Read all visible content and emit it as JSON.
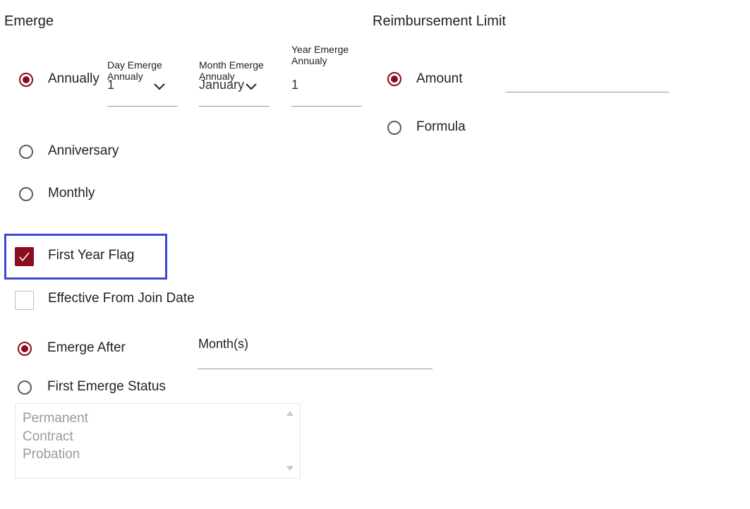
{
  "emerge": {
    "title": "Emerge",
    "options": {
      "annually": {
        "label": "Annually",
        "selected": true
      },
      "anniversary": {
        "label": "Anniversary",
        "selected": false
      },
      "monthly": {
        "label": "Monthly",
        "selected": false
      }
    },
    "day_field": {
      "label": "Day Emerge Annualy",
      "value": "1"
    },
    "month_field": {
      "label": "Month Emerge Annualy",
      "value": "January"
    },
    "year_field": {
      "label": "Year Emerge Annualy",
      "value": "1"
    },
    "first_year_flag": {
      "label": "First Year Flag",
      "checked": true
    },
    "effective_from_join_date": {
      "label": "Effective From Join Date",
      "checked": false
    },
    "emerge_after": {
      "label": "Emerge After",
      "selected": true
    },
    "months_field": {
      "label": "Month(s)",
      "value": ""
    },
    "first_emerge_status": {
      "label": "First Emerge Status",
      "selected": false
    },
    "status_options": [
      "Permanent",
      "Contract",
      "Probation"
    ]
  },
  "reimbursement": {
    "title": "Reimbursement Limit",
    "amount": {
      "label": "Amount",
      "selected": true,
      "value": ""
    },
    "formula": {
      "label": "Formula",
      "selected": false
    }
  },
  "colors": {
    "accent": "#8b0c1c",
    "focus_outline": "#3f48cc",
    "placeholder_text": "#9a9a9a"
  }
}
